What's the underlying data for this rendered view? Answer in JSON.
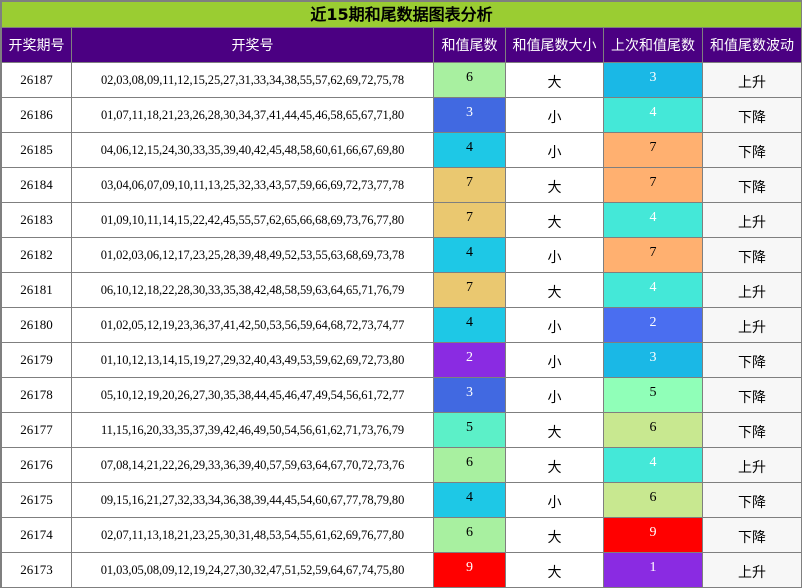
{
  "title": "近15期和尾数据图表分析",
  "headers": [
    "开奖期号",
    "开奖号",
    "和值尾数",
    "和值尾数大小",
    "上次和值尾数",
    "和值尾数波动"
  ],
  "palette": {
    "1": "#8a2be2",
    "2": "#8a2be2",
    "3": "#4169e1",
    "4": "#1ec8e6",
    "5": "#5cf0c8",
    "6": "#a8f0a0",
    "7": "#eac870",
    "9": "#ff0000",
    "prev_3": "#1ab8e6",
    "prev_4": "#44e8d8",
    "prev_5": "#90ffb8",
    "prev_6": "#c8e890",
    "prev_7": "#ffb070",
    "prev_2": "#4a6ef0",
    "prev_9": "#ff0000",
    "prev_1": "#8a2be2"
  },
  "chart_data": {
    "type": "table",
    "title": "近15期和尾数据图表分析",
    "columns": [
      "开奖期号",
      "开奖号",
      "和值尾数",
      "和值尾数大小",
      "上次和值尾数",
      "和值尾数波动"
    ],
    "rows": [
      {
        "period": "26187",
        "numbers": "02,03,08,09,11,12,15,25,27,31,33,34,38,55,57,62,69,72,75,78",
        "tail": 6,
        "size": "大",
        "prev": 3,
        "trend": "上升"
      },
      {
        "period": "26186",
        "numbers": "01,07,11,18,21,23,26,28,30,34,37,41,44,45,46,58,65,67,71,80",
        "tail": 3,
        "size": "小",
        "prev": 4,
        "trend": "下降"
      },
      {
        "period": "26185",
        "numbers": "04,06,12,15,24,30,33,35,39,40,42,45,48,58,60,61,66,67,69,80",
        "tail": 4,
        "size": "小",
        "prev": 7,
        "trend": "下降"
      },
      {
        "period": "26184",
        "numbers": "03,04,06,07,09,10,11,13,25,32,33,43,57,59,66,69,72,73,77,78",
        "tail": 7,
        "size": "大",
        "prev": 7,
        "trend": "下降"
      },
      {
        "period": "26183",
        "numbers": "01,09,10,11,14,15,22,42,45,55,57,62,65,66,68,69,73,76,77,80",
        "tail": 7,
        "size": "大",
        "prev": 4,
        "trend": "上升"
      },
      {
        "period": "26182",
        "numbers": "01,02,03,06,12,17,23,25,28,39,48,49,52,53,55,63,68,69,73,78",
        "tail": 4,
        "size": "小",
        "prev": 7,
        "trend": "下降"
      },
      {
        "period": "26181",
        "numbers": "06,10,12,18,22,28,30,33,35,38,42,48,58,59,63,64,65,71,76,79",
        "tail": 7,
        "size": "大",
        "prev": 4,
        "trend": "上升"
      },
      {
        "period": "26180",
        "numbers": "01,02,05,12,19,23,36,37,41,42,50,53,56,59,64,68,72,73,74,77",
        "tail": 4,
        "size": "小",
        "prev": 2,
        "trend": "上升"
      },
      {
        "period": "26179",
        "numbers": "01,10,12,13,14,15,19,27,29,32,40,43,49,53,59,62,69,72,73,80",
        "tail": 2,
        "size": "小",
        "prev": 3,
        "trend": "下降"
      },
      {
        "period": "26178",
        "numbers": "05,10,12,19,20,26,27,30,35,38,44,45,46,47,49,54,56,61,72,77",
        "tail": 3,
        "size": "小",
        "prev": 5,
        "trend": "下降"
      },
      {
        "period": "26177",
        "numbers": "11,15,16,20,33,35,37,39,42,46,49,50,54,56,61,62,71,73,76,79",
        "tail": 5,
        "size": "大",
        "prev": 6,
        "trend": "下降"
      },
      {
        "period": "26176",
        "numbers": "07,08,14,21,22,26,29,33,36,39,40,57,59,63,64,67,70,72,73,76",
        "tail": 6,
        "size": "大",
        "prev": 4,
        "trend": "上升"
      },
      {
        "period": "26175",
        "numbers": "09,15,16,21,27,32,33,34,36,38,39,44,45,54,60,67,77,78,79,80",
        "tail": 4,
        "size": "小",
        "prev": 6,
        "trend": "下降"
      },
      {
        "period": "26174",
        "numbers": "02,07,11,13,18,21,23,25,30,31,48,53,54,55,61,62,69,76,77,80",
        "tail": 6,
        "size": "大",
        "prev": 9,
        "trend": "下降"
      },
      {
        "period": "26173",
        "numbers": "01,03,05,08,09,12,19,24,27,30,32,47,51,52,59,64,67,74,75,80",
        "tail": 9,
        "size": "大",
        "prev": 1,
        "trend": "上升"
      }
    ]
  }
}
